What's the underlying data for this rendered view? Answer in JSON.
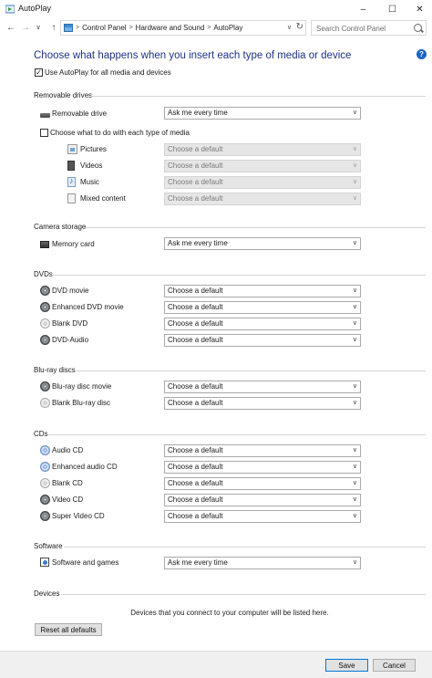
{
  "window": {
    "title": "AutoPlay",
    "minimize_label": "–",
    "maximize_label": "☐",
    "close_label": "✕"
  },
  "nav": {
    "back": "←",
    "forward": "→",
    "recent": "∨",
    "up": "↑"
  },
  "address": {
    "breadcrumbs": [
      "Control Panel",
      "Hardware and Sound",
      "AutoPlay"
    ],
    "separator": ">",
    "dropdown": "∨",
    "refresh": "↻"
  },
  "search": {
    "placeholder": "Search Control Panel"
  },
  "page": {
    "title": "Choose what happens when you insert each type of media or device",
    "help": "?"
  },
  "use_autoplay": {
    "label": "Use AutoPlay for all media and devices",
    "checked": true,
    "mark": "✓"
  },
  "removable": {
    "heading": "Removable drives",
    "drive_label": "Removable drive",
    "drive_value": "Ask me every time",
    "choose_each_label": "Choose what to do with each type of media",
    "choose_each_checked": false,
    "media": [
      {
        "label": "Pictures",
        "value": "Choose a default",
        "icon": "pictures-icon"
      },
      {
        "label": "Videos",
        "value": "Choose a default",
        "icon": "videos-icon"
      },
      {
        "label": "Music",
        "value": "Choose a default",
        "icon": "music-icon"
      },
      {
        "label": "Mixed content",
        "value": "Choose a default",
        "icon": "mixed-content-icon"
      }
    ]
  },
  "camera": {
    "heading": "Camera storage",
    "items": [
      {
        "label": "Memory card",
        "value": "Ask me every time",
        "icon": "memory-card-icon"
      }
    ]
  },
  "dvds": {
    "heading": "DVDs",
    "items": [
      {
        "label": "DVD movie",
        "value": "Choose a default",
        "icon": "dvd-icon"
      },
      {
        "label": "Enhanced DVD movie",
        "value": "Choose a default",
        "icon": "dvd-icon"
      },
      {
        "label": "Blank DVD",
        "value": "Choose a default",
        "icon": "blank-disc-icon"
      },
      {
        "label": "DVD-Audio",
        "value": "Choose a default",
        "icon": "dvd-icon"
      }
    ]
  },
  "bluray": {
    "heading": "Blu-ray discs",
    "items": [
      {
        "label": "Blu-ray disc movie",
        "value": "Choose a default",
        "icon": "bluray-icon"
      },
      {
        "label": "Blank Blu-ray disc",
        "value": "Choose a default",
        "icon": "blank-disc-icon"
      }
    ]
  },
  "cds": {
    "heading": "CDs",
    "items": [
      {
        "label": "Audio CD",
        "value": "Choose a default",
        "icon": "cd-icon"
      },
      {
        "label": "Enhanced audio CD",
        "value": "Choose a default",
        "icon": "cd-icon"
      },
      {
        "label": "Blank CD",
        "value": "Choose a default",
        "icon": "blank-disc-icon"
      },
      {
        "label": "Video CD",
        "value": "Choose a default",
        "icon": "dvd-icon"
      },
      {
        "label": "Super Video CD",
        "value": "Choose a default",
        "icon": "dvd-icon"
      }
    ]
  },
  "software": {
    "heading": "Software",
    "items": [
      {
        "label": "Software and games",
        "value": "Ask me every time",
        "icon": "software-icon"
      }
    ]
  },
  "devices": {
    "heading": "Devices",
    "note": "Devices that you connect to your computer will be listed here."
  },
  "buttons": {
    "reset": "Reset all defaults",
    "save": "Save",
    "cancel": "Cancel"
  },
  "chevron": "∨"
}
